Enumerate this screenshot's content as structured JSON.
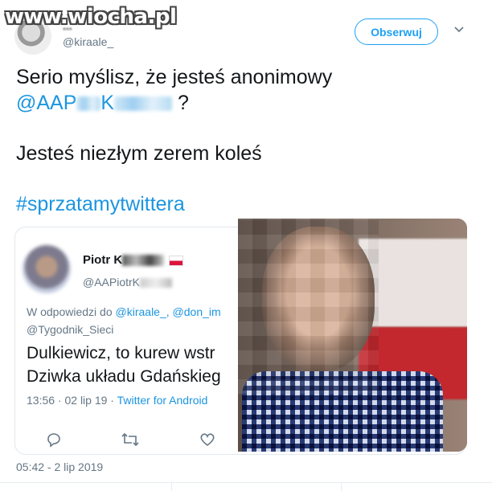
{
  "watermark": "www.wiocha.pl",
  "author": {
    "name": "...",
    "handle": "@kiraale_"
  },
  "follow_label": "Obserwuj",
  "tweet": {
    "line1": "Serio myślisz, że jesteś anonimowy",
    "mention_prefix": "@AAP",
    "mention_mid": "K",
    "mention_suffix": "?",
    "line3": "Jesteś niezłym zerem koleś",
    "hashtag": "#sprzatamytwittera"
  },
  "quoted": {
    "name": "Piotr K",
    "handle": "@AAPiotrK",
    "reply_prefix": "W odpowiedzi do",
    "reply_handles": "@kiraale_, @don_im",
    "reply_handle2": "@Tygodnik_Sieci",
    "text_line1": "Dulkiewicz, to kurew wstr",
    "text_line2": "Dziwka układu Gdańskieg",
    "time": "13:56 · 02 lip 19 · ",
    "client": "Twitter for Android"
  },
  "timestamp": "05:42 - 2 lip 2019",
  "colors": {
    "accent": "#1da1f2",
    "link": "#1b95e0",
    "muted": "#657786",
    "text": "#14171a"
  }
}
